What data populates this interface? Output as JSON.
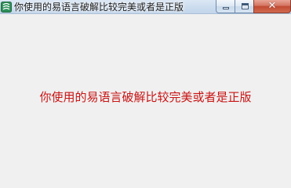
{
  "window": {
    "title": "你使用的易语言破解比较完美或者是正版",
    "app_icon": "app-icon",
    "controls": {
      "minimize_icon": "minimize-icon",
      "maximize_icon": "maximize-icon",
      "close_icon": "close-icon",
      "close_glyph": "✕"
    }
  },
  "content": {
    "message": "你使用的易语言破解比较完美或者是正版",
    "message_color": "#c81414"
  }
}
